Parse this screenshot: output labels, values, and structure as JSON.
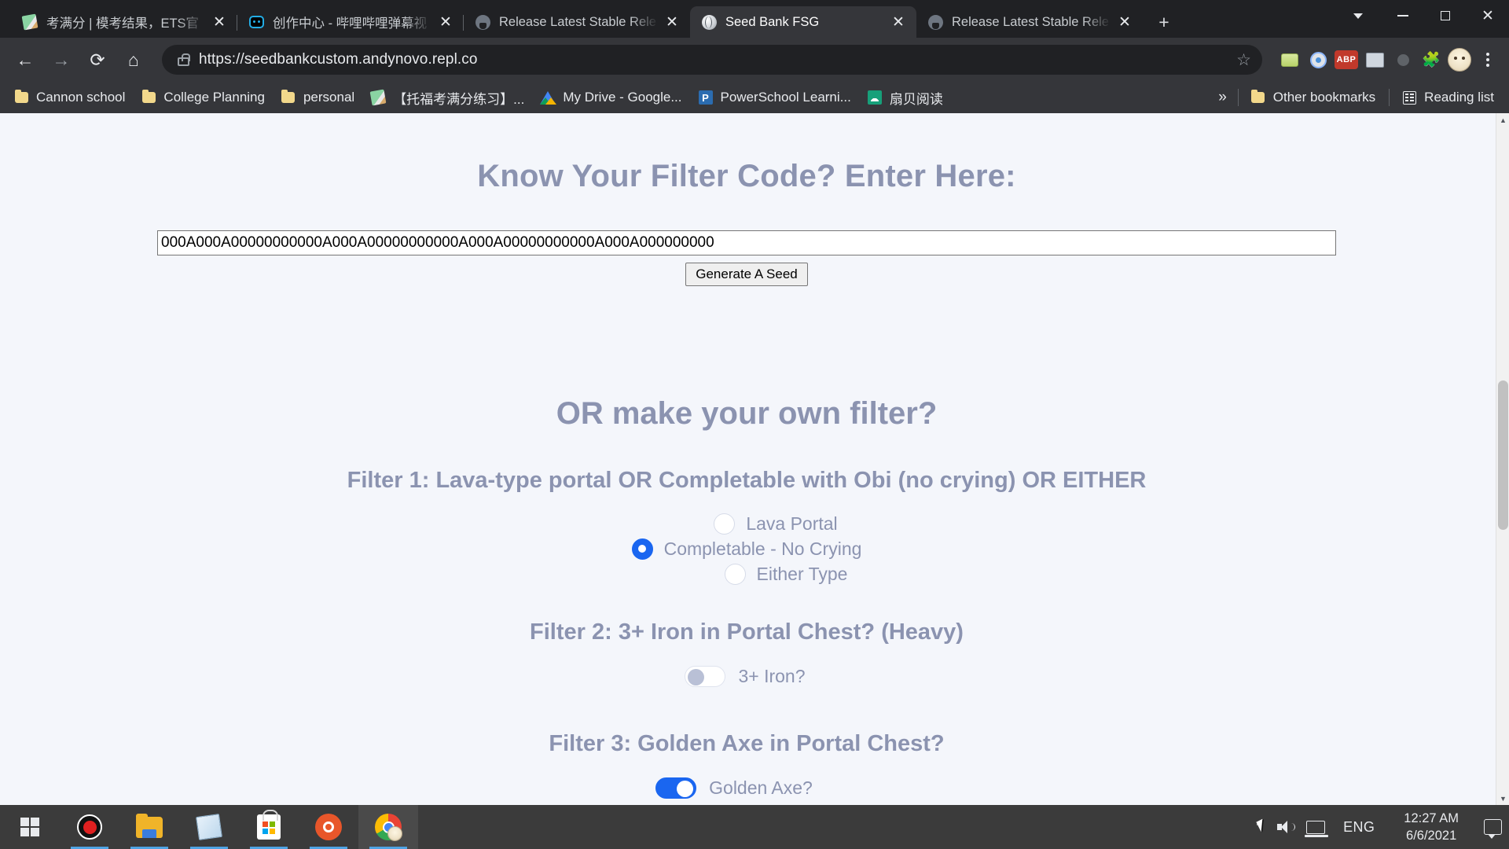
{
  "browser": {
    "tabs": [
      {
        "title": "考满分 | 模考结果，ETS官",
        "icon": "pencil-icon",
        "active": false,
        "close_label": "✕"
      },
      {
        "title": "创作中心 - 哔哩哔哩弹幕视",
        "icon": "bilibili-icon",
        "active": false,
        "close_label": "✕"
      },
      {
        "title": "Release Latest Stable Rele",
        "icon": "github-icon",
        "active": false,
        "close_label": "✕"
      },
      {
        "title": "Seed Bank FSG",
        "icon": "globe-icon",
        "active": true,
        "close_label": "✕"
      },
      {
        "title": "Release Latest Stable Rele",
        "icon": "github-icon",
        "active": false,
        "close_label": "✕"
      }
    ],
    "new_tab_label": "+",
    "window_controls": {
      "profile_chevron": "chevron-down-icon",
      "minimize": "—",
      "maximize": "▢",
      "close": "✕"
    },
    "toolbar": {
      "back": "←",
      "forward": "→",
      "reload": "⟳",
      "home": "⌂",
      "url": "https://seedbankcustom.andynovo.repl.co",
      "lock": "lock-icon",
      "bookmark_star": "☆",
      "extensions": [
        "extension-green",
        "extension-blue",
        "ABP",
        "extension-image",
        "extension-gray",
        "puzzle-icon"
      ],
      "menu": "kebab-menu-icon"
    },
    "bookmarks": [
      {
        "label": "Cannon school",
        "icon": "folder"
      },
      {
        "label": "College Planning",
        "icon": "folder"
      },
      {
        "label": "personal",
        "icon": "folder"
      },
      {
        "label": "【托福考满分练习】...",
        "icon": "pencil"
      },
      {
        "label": "My Drive - Google...",
        "icon": "gdrive"
      },
      {
        "label": "PowerSchool Learni...",
        "icon": "powerschool"
      },
      {
        "label": "扇贝阅读",
        "icon": "shanbei"
      }
    ],
    "bookmarks_overflow": "»",
    "other_bookmarks": "Other bookmarks",
    "reading_list": "Reading list"
  },
  "page": {
    "filter_code_heading": "Know Your Filter Code? Enter Here:",
    "filter_code_value": "000A000A00000000000A000A00000000000A000A00000000000A000A000000000",
    "filter_code_placeholder": "",
    "generate_button": "Generate A Seed",
    "or_heading": "OR make your own filter?",
    "filters": [
      {
        "heading": "Filter 1: Lava-type portal OR Completable with Obi (no crying) OR EITHER",
        "type": "radio",
        "options": [
          {
            "label": "Lava Portal",
            "checked": false
          },
          {
            "label": "Completable - No Crying",
            "checked": true
          },
          {
            "label": "Either Type",
            "checked": false
          }
        ]
      },
      {
        "heading": "Filter 2: 3+ Iron in Portal Chest? (Heavy)",
        "type": "toggle",
        "options": [
          {
            "label": "3+ Iron?",
            "on": false
          }
        ]
      },
      {
        "heading": "Filter 3: Golden Axe in Portal Chest?",
        "type": "toggle",
        "options": [
          {
            "label": "Golden Axe?",
            "on": true
          }
        ]
      }
    ]
  },
  "taskbar": {
    "items": [
      {
        "name": "start-button",
        "icon": "windows-logo-icon",
        "running": false
      },
      {
        "name": "screen-recorder",
        "icon": "record-icon",
        "running": true
      },
      {
        "name": "file-explorer",
        "icon": "folder-icon",
        "running": true
      },
      {
        "name": "sticky-notes",
        "icon": "sticky-notes-icon",
        "running": true
      },
      {
        "name": "microsoft-store",
        "icon": "store-icon",
        "running": true
      },
      {
        "name": "ubuntu",
        "icon": "ubuntu-icon",
        "running": true
      },
      {
        "name": "google-chrome",
        "icon": "chrome-icon",
        "running": true
      }
    ],
    "tray": {
      "overflow_chevron": "⌃",
      "volume": "speaker-icon",
      "network": "network-icon",
      "language": "ENG",
      "time": "12:27 AM",
      "date": "6/6/2021",
      "action_center": "notifications-icon"
    }
  },
  "colors": {
    "accent_blue": "#1a66f0",
    "heading_text": "#8b93b0",
    "page_bg": "#f4f6fb",
    "chrome_dark": "#202124",
    "chrome_toolbar": "#35363a"
  }
}
